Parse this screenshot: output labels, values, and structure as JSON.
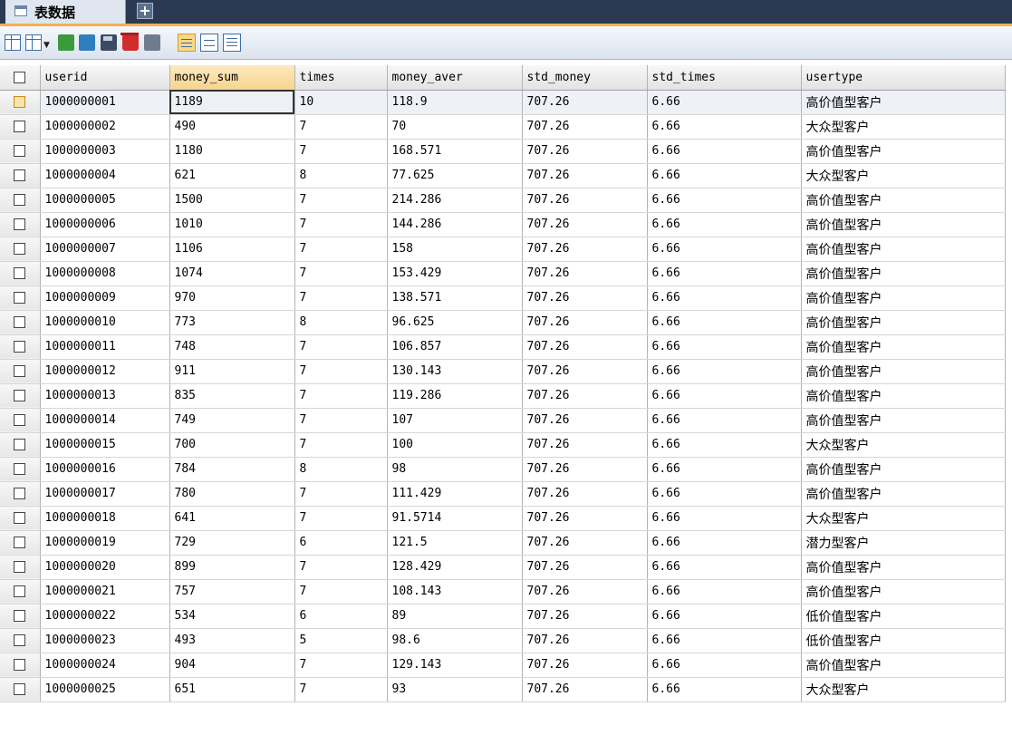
{
  "tab": {
    "label": "表数据",
    "new_tab_label": "+"
  },
  "columns": [
    "userid",
    "money_sum",
    "times",
    "money_aver",
    "std_money",
    "std_times",
    "usertype"
  ],
  "rows": [
    [
      "1000000001",
      "1189",
      "10",
      "118.9",
      "707.26",
      "6.66",
      "高价值型客户"
    ],
    [
      "1000000002",
      "490",
      "7",
      "70",
      "707.26",
      "6.66",
      "大众型客户"
    ],
    [
      "1000000003",
      "1180",
      "7",
      "168.571",
      "707.26",
      "6.66",
      "高价值型客户"
    ],
    [
      "1000000004",
      "621",
      "8",
      "77.625",
      "707.26",
      "6.66",
      "大众型客户"
    ],
    [
      "1000000005",
      "1500",
      "7",
      "214.286",
      "707.26",
      "6.66",
      "高价值型客户"
    ],
    [
      "1000000006",
      "1010",
      "7",
      "144.286",
      "707.26",
      "6.66",
      "高价值型客户"
    ],
    [
      "1000000007",
      "1106",
      "7",
      "158",
      "707.26",
      "6.66",
      "高价值型客户"
    ],
    [
      "1000000008",
      "1074",
      "7",
      "153.429",
      "707.26",
      "6.66",
      "高价值型客户"
    ],
    [
      "1000000009",
      "970",
      "7",
      "138.571",
      "707.26",
      "6.66",
      "高价值型客户"
    ],
    [
      "1000000010",
      "773",
      "8",
      "96.625",
      "707.26",
      "6.66",
      "高价值型客户"
    ],
    [
      "1000000011",
      "748",
      "7",
      "106.857",
      "707.26",
      "6.66",
      "高价值型客户"
    ],
    [
      "1000000012",
      "911",
      "7",
      "130.143",
      "707.26",
      "6.66",
      "高价值型客户"
    ],
    [
      "1000000013",
      "835",
      "7",
      "119.286",
      "707.26",
      "6.66",
      "高价值型客户"
    ],
    [
      "1000000014",
      "749",
      "7",
      "107",
      "707.26",
      "6.66",
      "高价值型客户"
    ],
    [
      "1000000015",
      "700",
      "7",
      "100",
      "707.26",
      "6.66",
      "大众型客户"
    ],
    [
      "1000000016",
      "784",
      "8",
      "98",
      "707.26",
      "6.66",
      "高价值型客户"
    ],
    [
      "1000000017",
      "780",
      "7",
      "111.429",
      "707.26",
      "6.66",
      "高价值型客户"
    ],
    [
      "1000000018",
      "641",
      "7",
      "91.5714",
      "707.26",
      "6.66",
      "大众型客户"
    ],
    [
      "1000000019",
      "729",
      "6",
      "121.5",
      "707.26",
      "6.66",
      "潜力型客户"
    ],
    [
      "1000000020",
      "899",
      "7",
      "128.429",
      "707.26",
      "6.66",
      "高价值型客户"
    ],
    [
      "1000000021",
      "757",
      "7",
      "108.143",
      "707.26",
      "6.66",
      "高价值型客户"
    ],
    [
      "1000000022",
      "534",
      "6",
      "89",
      "707.26",
      "6.66",
      "低价值型客户"
    ],
    [
      "1000000023",
      "493",
      "5",
      "98.6",
      "707.26",
      "6.66",
      "低价值型客户"
    ],
    [
      "1000000024",
      "904",
      "7",
      "129.143",
      "707.26",
      "6.66",
      "高价值型客户"
    ],
    [
      "1000000025",
      "651",
      "7",
      "93",
      "707.26",
      "6.66",
      "大众型客户"
    ]
  ],
  "colors": {
    "tabbar": "#2b3a52",
    "accent": "#f6b14a",
    "sorted_header": "#f7d48f"
  }
}
